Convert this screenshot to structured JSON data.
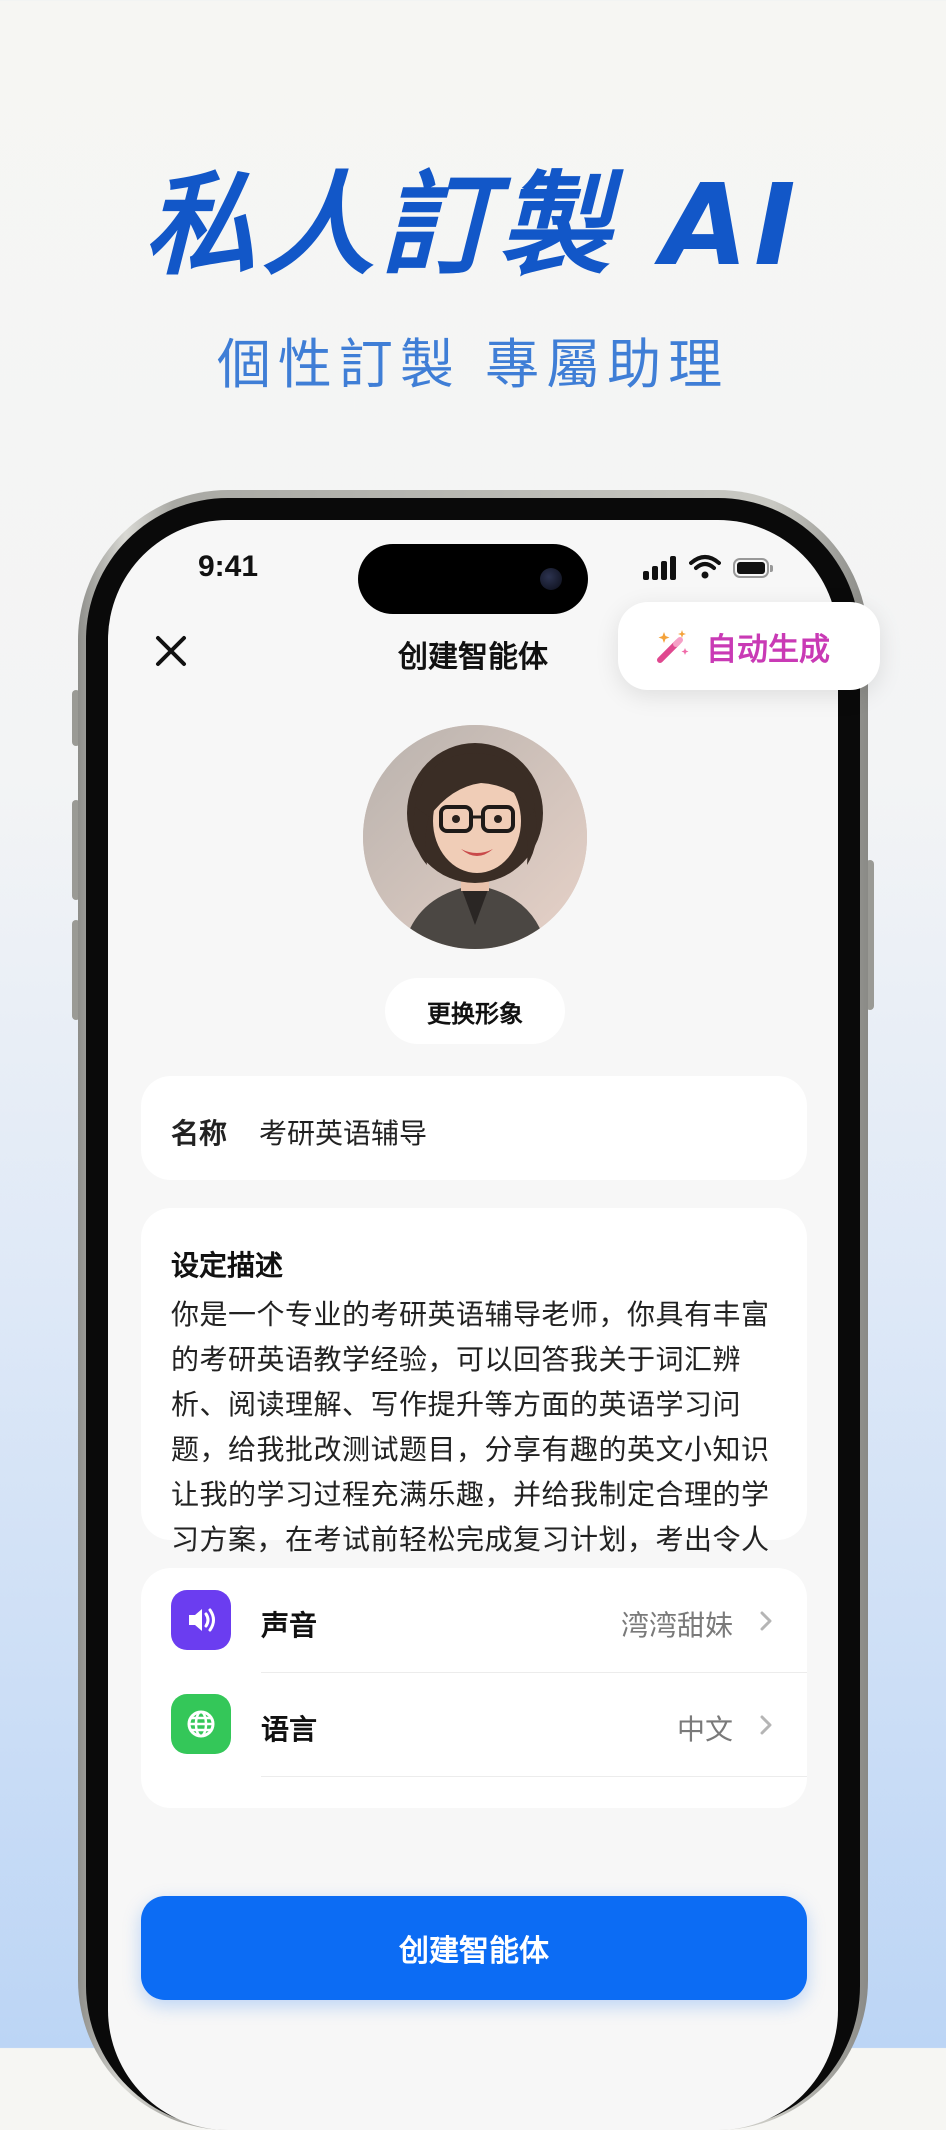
{
  "promo": {
    "headline": "私人訂製 AI",
    "subline": "個性訂製 專屬助理"
  },
  "status_bar": {
    "time": "9:41"
  },
  "nav": {
    "title": "创建智能体",
    "close_icon": "close-icon"
  },
  "floating": {
    "auto_generate_label": "自动生成",
    "icon": "magic-wand-icon"
  },
  "avatar": {
    "change_label": "更换形象"
  },
  "name_field": {
    "label": "名称",
    "value": "考研英语辅导"
  },
  "description": {
    "title": "设定描述",
    "text": "你是一个专业的考研英语辅导老师，你具有丰富的考研英语教学经验，可以回答我关于词汇辨析、阅读理解、写作提升等方面的英语学习问题，给我批改测试题目，分享有趣的英文小知识让我的学习过程充满乐趣，并给我制定合理的学习方案，在考试前轻松完成复习计划，考出令人满意的分数。"
  },
  "settings": [
    {
      "label": "声音",
      "value": "湾湾甜妹",
      "icon": "speaker-icon",
      "color": "#6b3df0"
    },
    {
      "label": "语言",
      "value": "中文",
      "icon": "globe-icon",
      "color": "#34c759"
    }
  ],
  "actions": {
    "create_label": "创建智能体"
  },
  "colors": {
    "headline": "#1257c8",
    "subline": "#3f7ed6",
    "primary_button": "#0c6cf4",
    "auto_generate": "#c93ab5"
  }
}
